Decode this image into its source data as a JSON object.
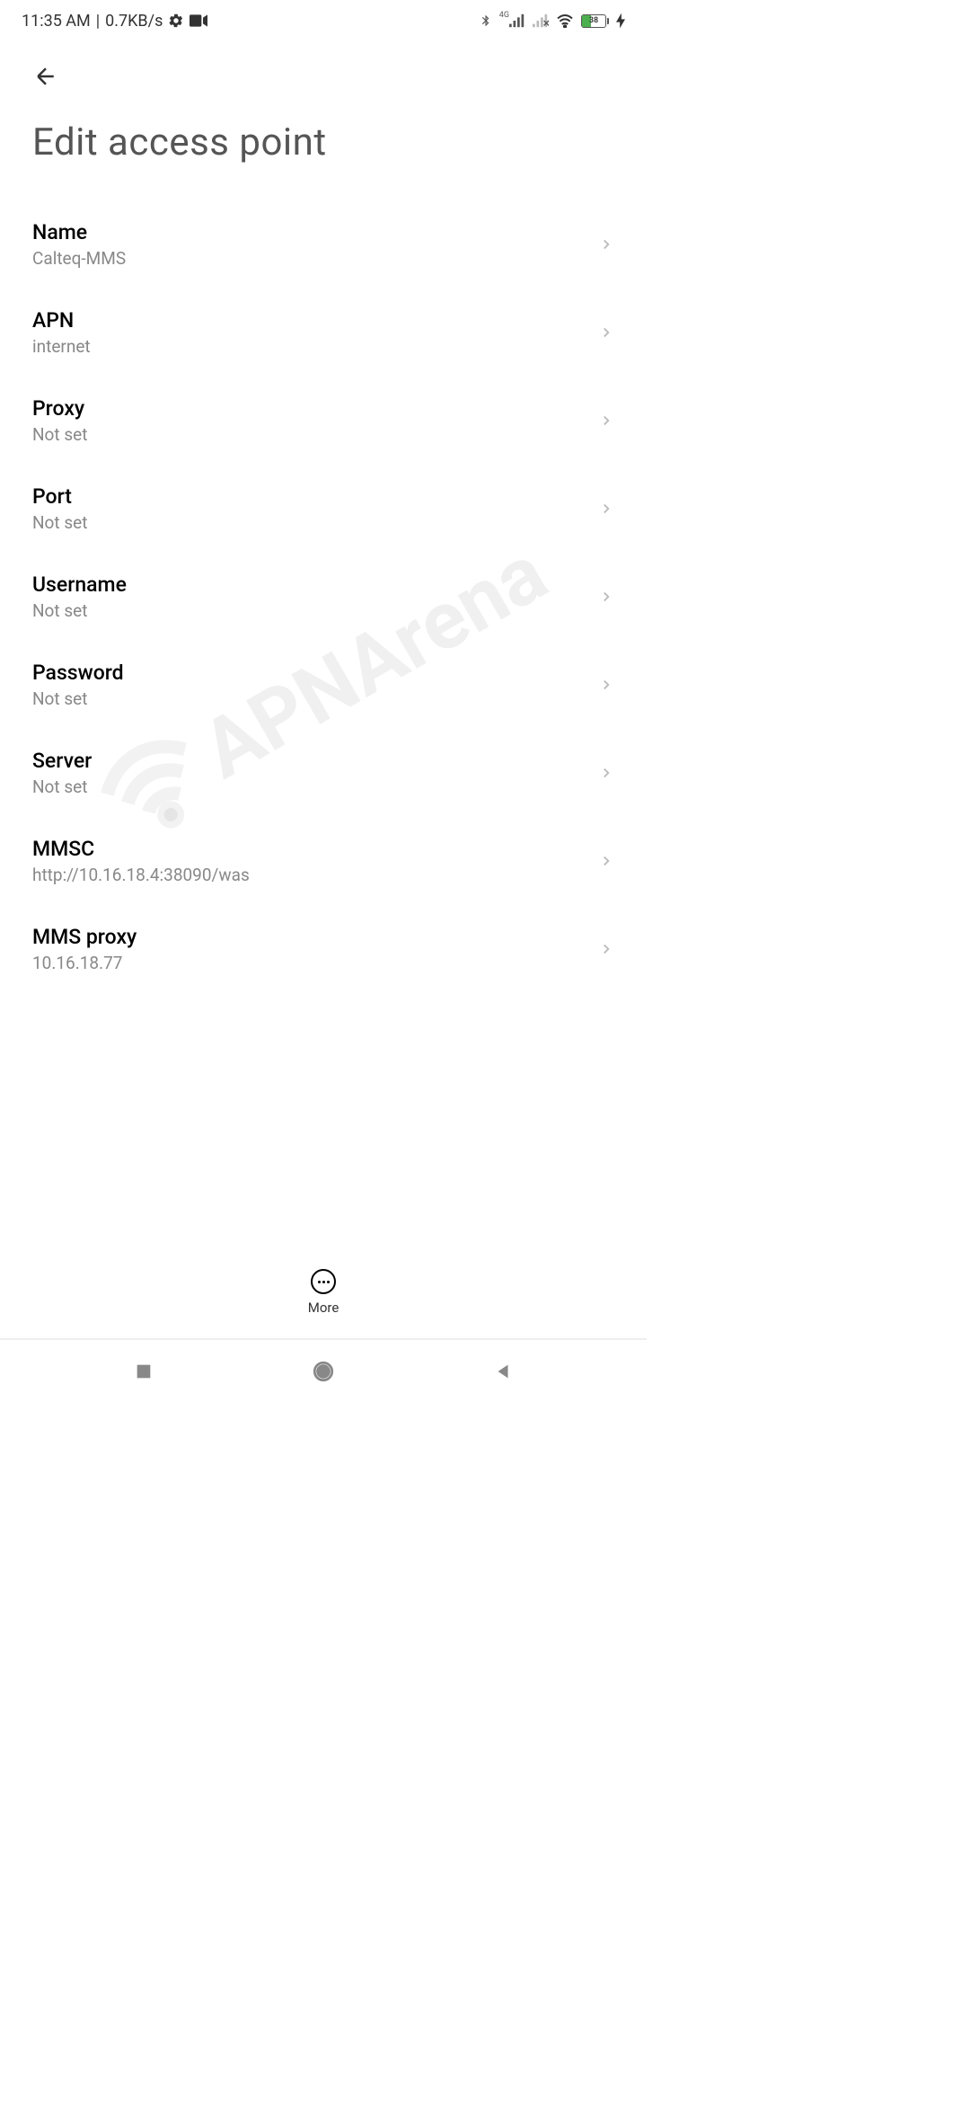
{
  "status_bar": {
    "time": "11:35 AM",
    "separator": "|",
    "data_rate": "0.7KB/s",
    "network_label": "4G",
    "battery_percent": "38"
  },
  "header": {
    "title": "Edit access point"
  },
  "settings": [
    {
      "label": "Name",
      "value": "Calteq-MMS"
    },
    {
      "label": "APN",
      "value": "internet"
    },
    {
      "label": "Proxy",
      "value": "Not set"
    },
    {
      "label": "Port",
      "value": "Not set"
    },
    {
      "label": "Username",
      "value": "Not set"
    },
    {
      "label": "Password",
      "value": "Not set"
    },
    {
      "label": "Server",
      "value": "Not set"
    },
    {
      "label": "MMSC",
      "value": "http://10.16.18.4:38090/was"
    },
    {
      "label": "MMS proxy",
      "value": "10.16.18.77"
    }
  ],
  "bottom_action": {
    "label": "More"
  },
  "watermark": {
    "text": "APNArena"
  }
}
